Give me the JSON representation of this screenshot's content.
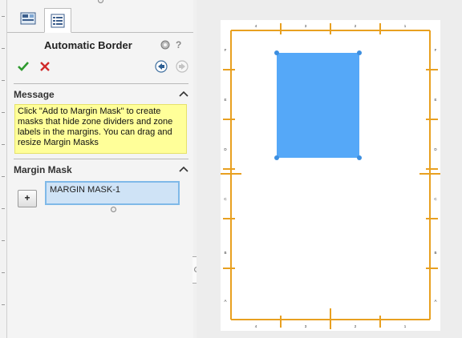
{
  "tabs": [
    {
      "name": "property-manager-tab",
      "icon": "property-manager-icon"
    },
    {
      "name": "feature-tree-tab",
      "icon": "tree-list-icon",
      "active": true
    }
  ],
  "header": {
    "title": "Automatic Border",
    "help_symbol": "?"
  },
  "actions": {
    "ok_icon": "checkmark-icon",
    "cancel_icon": "x-icon",
    "back_icon": "back-arrow-icon",
    "next_icon": "next-arrow-icon"
  },
  "message": {
    "heading": "Message",
    "text": "Click \"Add to Margin Mask\" to create masks that hide zone dividers and zone labels in the margins. You can drag and resize Margin Masks"
  },
  "margin_mask": {
    "heading": "Margin Mask",
    "add_label": "+",
    "items": [
      "MARGIN MASK-1"
    ]
  },
  "drawing": {
    "border_color": "#e8a020",
    "mask_color": "#55a8f8",
    "col_labels": [
      "4",
      "3",
      "2",
      "1"
    ],
    "row_labels_left": [
      "F",
      "E",
      "D",
      "C",
      "B",
      "A"
    ],
    "row_labels_right": [
      "F",
      "E",
      "D",
      "C",
      "B",
      "A"
    ]
  }
}
